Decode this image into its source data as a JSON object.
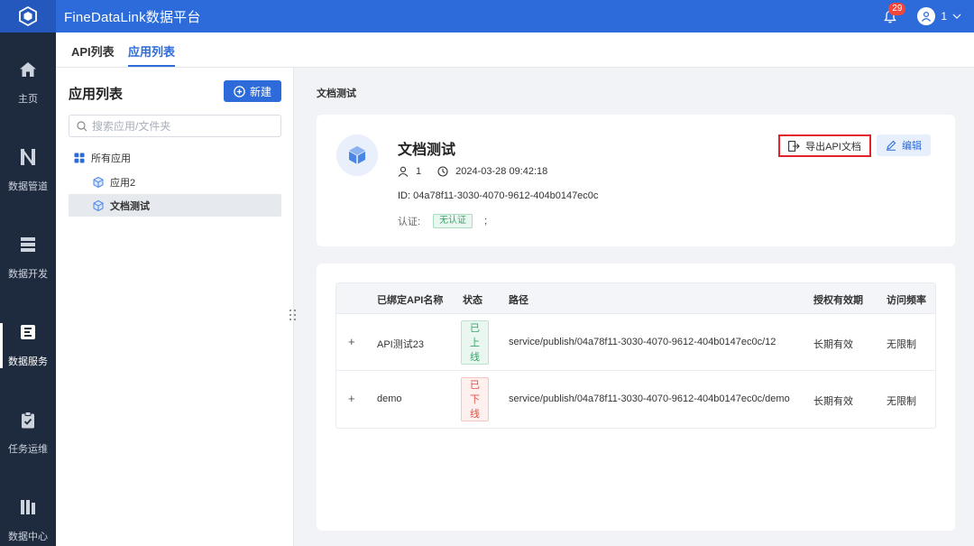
{
  "header": {
    "title": "FineDataLink数据平台",
    "notification_count": "29",
    "user_name": "1"
  },
  "nav": {
    "items": [
      {
        "label": "主页",
        "icon": "home-icon"
      },
      {
        "label": "数据管道",
        "icon": "pipeline-icon"
      },
      {
        "label": "数据开发",
        "icon": "dev-icon"
      },
      {
        "label": "数据服务",
        "icon": "service-icon",
        "active": true
      },
      {
        "label": "任务运维",
        "icon": "ops-icon"
      },
      {
        "label": "数据中心",
        "icon": "datacenter-icon"
      }
    ]
  },
  "tabs": [
    {
      "label": "API列表"
    },
    {
      "label": "应用列表",
      "active": true
    }
  ],
  "panel": {
    "title": "应用列表",
    "new_label": "新建",
    "search_placeholder": "搜索应用/文件夹",
    "tree": [
      {
        "label": "所有应用"
      },
      {
        "label": "应用2"
      },
      {
        "label": "文档测试",
        "selected": true
      }
    ]
  },
  "breadcrumb": "文档测试",
  "app": {
    "name": "文档测试",
    "owner": "1",
    "created": "2024-03-28 09:42:18",
    "id_text": "ID: 04a78f11-3030-4070-9612-404b0147ec0c",
    "auth_label": "认证:",
    "auth_value": "无认证",
    "auth_sep": ";",
    "export_label": "导出API文档",
    "edit_label": "编辑"
  },
  "table": {
    "headers": {
      "name": "已绑定API名称",
      "status": "状态",
      "path": "路径",
      "validity": "授权有效期",
      "frequency": "访问频率"
    },
    "rows": [
      {
        "expand": "+",
        "name": "API测试23",
        "status_chars": [
          "已",
          "上",
          "线"
        ],
        "status_type": "online",
        "path": "service/publish/04a78f11-3030-4070-9612-404b0147ec0c/12",
        "validity": "长期有效",
        "frequency": "无限制"
      },
      {
        "expand": "+",
        "name": "demo",
        "status_chars": [
          "已",
          "下",
          "线"
        ],
        "status_type": "offline",
        "path": "service/publish/04a78f11-3030-4070-9612-404b0147ec0c/demo",
        "validity": "长期有效",
        "frequency": "无限制"
      }
    ]
  },
  "colors": {
    "primary": "#2c6bd9",
    "sidebar": "#1e2a3e",
    "online": "#3aa46c",
    "offline": "#e0534a",
    "highlight_border": "#e0242a"
  }
}
